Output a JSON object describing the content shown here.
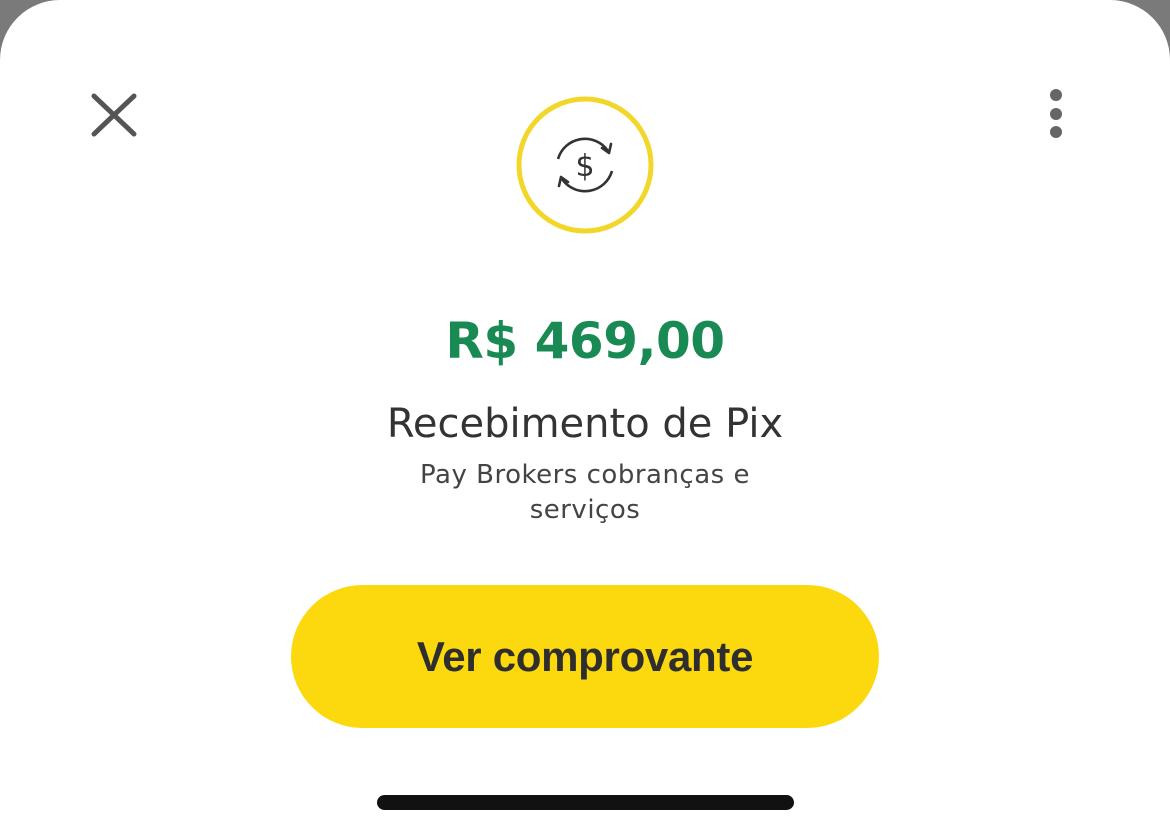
{
  "header": {
    "close_icon": "close-icon",
    "more_icon": "more-vertical-icon"
  },
  "transaction": {
    "icon": "currency-exchange-icon",
    "amount": "R$ 469,00",
    "title": "Recebimento de Pix",
    "counterparty": "Pay Brokers cobranças e serviços"
  },
  "actions": {
    "view_receipt_label": "Ver comprovante"
  },
  "colors": {
    "accent_yellow": "#fcd80f",
    "amount_green": "#1a8a55",
    "text_dark": "#333333"
  }
}
